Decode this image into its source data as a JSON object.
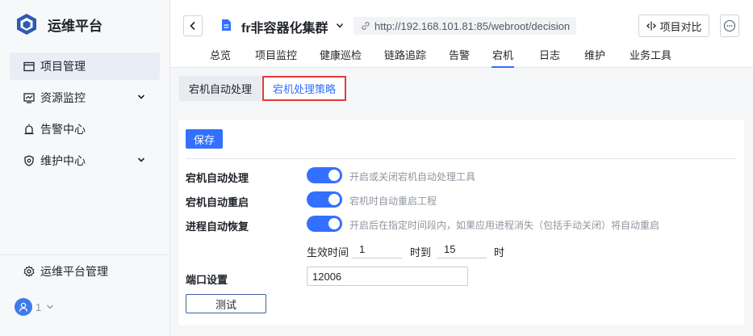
{
  "brand": {
    "name": "运维平台"
  },
  "sidebar": {
    "items": [
      {
        "label": "项目管理",
        "icon": "window-icon",
        "active": true
      },
      {
        "label": "资源监控",
        "icon": "monitor-chart-icon",
        "expandable": true
      },
      {
        "label": "告警中心",
        "icon": "alarm-light-icon"
      },
      {
        "label": "维护中心",
        "icon": "maintenance-shield-icon",
        "expandable": true
      }
    ],
    "footer": {
      "label": "运维平台管理",
      "icon": "gear-icon"
    },
    "user": {
      "count": "1"
    }
  },
  "header": {
    "project_name": "fr非容器化集群",
    "url": "http://192.168.101.81:85/webroot/decision",
    "compare_label": "项目对比",
    "tabs": [
      {
        "label": "总览"
      },
      {
        "label": "项目监控"
      },
      {
        "label": "健康巡检"
      },
      {
        "label": "链路追踪"
      },
      {
        "label": "告警"
      },
      {
        "label": "宕机",
        "active": true
      },
      {
        "label": "日志"
      },
      {
        "label": "维护"
      },
      {
        "label": "业务工具"
      }
    ]
  },
  "subtabs": [
    {
      "label": "宕机自动处理"
    },
    {
      "label": "宕机处理策略",
      "active": true
    }
  ],
  "form": {
    "save_label": "保存",
    "rows": [
      {
        "label": "宕机自动处理",
        "enabled": true,
        "desc": "开启或关闭宕机自动处理工具"
      },
      {
        "label": "宕机自动重启",
        "enabled": true,
        "desc": "宕机时自动重启工程"
      },
      {
        "label": "进程自动恢复",
        "enabled": true,
        "desc": "开启后在指定时间段内，如果应用进程消失（包括手动关闭）将自动重启"
      }
    ],
    "time": {
      "start_label": "生效时间",
      "start_value": "1",
      "mid_label": "时到",
      "end_value": "15",
      "end_label": "时"
    },
    "port": {
      "label": "端口设置",
      "value": "12006"
    },
    "test_label": "测试"
  },
  "colors": {
    "accent": "#3370ff",
    "highlight_border": "#e33a3a"
  }
}
